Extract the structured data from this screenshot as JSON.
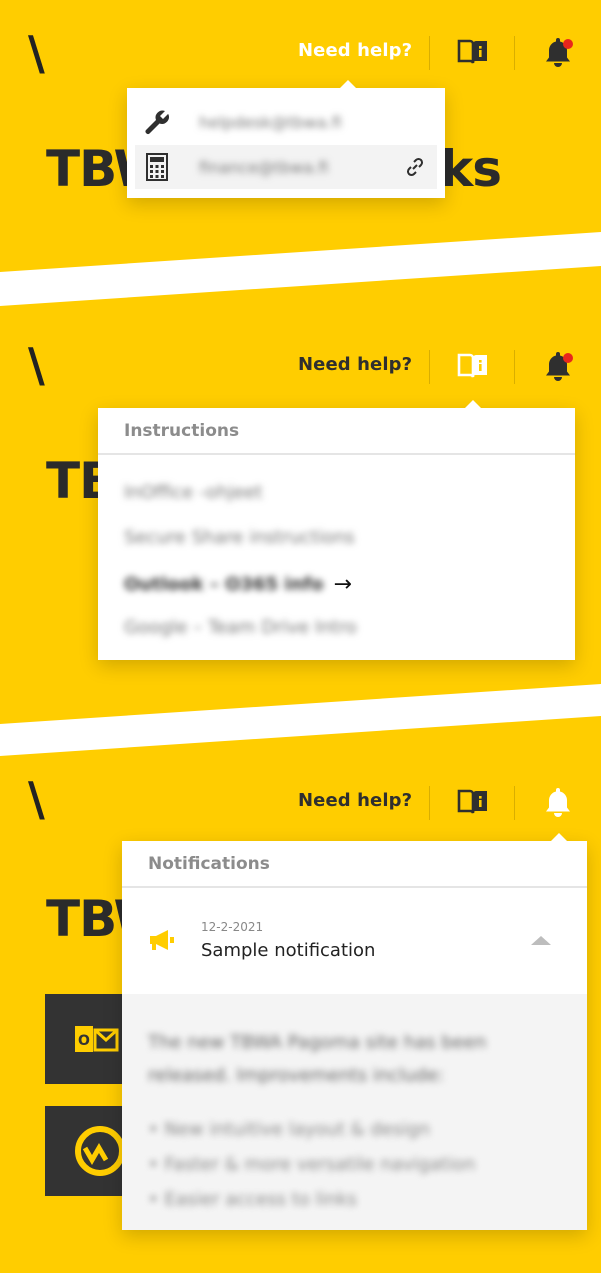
{
  "header": {
    "logo_glyph": "\\",
    "need_help": "Need help?",
    "book_icon": "book-info-icon",
    "bell_icon": "bell-icon"
  },
  "page_title_left": "TBW",
  "page_title_right": "ks",
  "panel1": {
    "help_items": [
      {
        "icon": "wrench-icon",
        "text": "helpdesk@tbwa.fi"
      },
      {
        "icon": "calculator-icon",
        "text": "finance@tbwa.fi",
        "link_icon": "link-icon"
      }
    ]
  },
  "panel2": {
    "instructions_title": "Instructions",
    "items": [
      {
        "label": "InOffice -ohjeet"
      },
      {
        "label": "Secure Share instructions"
      },
      {
        "label": "Outlook – O365 info",
        "arrow": "→"
      },
      {
        "label": "Google – Team Drive Intro"
      }
    ]
  },
  "panel3": {
    "notifications_title": "Notifications",
    "notification": {
      "date": "12-2-2021",
      "title": "Sample notification",
      "icon": "megaphone-icon",
      "body": "The new TBWA Pagoma site has been released. Improvements include:",
      "bullets": [
        "New intuitive layout & design",
        "Faster & more versatile navigation",
        "Easier access to links"
      ]
    },
    "app_tiles": [
      "outlook-icon",
      "workplace-icon"
    ]
  },
  "colors": {
    "brand_yellow": "#ffcd00",
    "dark": "#2f2f2f",
    "badge_red": "#e8271c"
  }
}
